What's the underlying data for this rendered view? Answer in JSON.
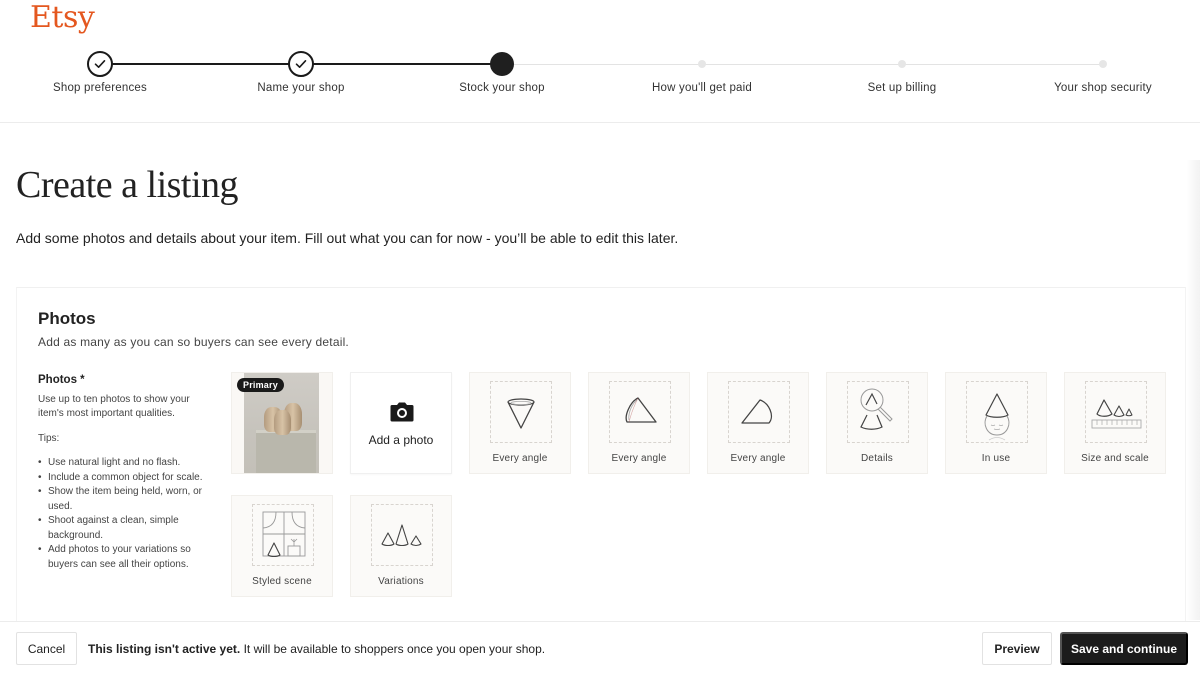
{
  "brand": {
    "name": "Etsy",
    "color": "#e4571f"
  },
  "stepper": {
    "current_index": 2,
    "steps": [
      {
        "label": "Shop preferences",
        "state": "complete"
      },
      {
        "label": "Name your shop",
        "state": "complete"
      },
      {
        "label": "Stock your shop",
        "state": "current"
      },
      {
        "label": "How you'll get paid",
        "state": "pending"
      },
      {
        "label": "Set up billing",
        "state": "pending"
      },
      {
        "label": "Your shop security",
        "state": "pending"
      }
    ]
  },
  "page": {
    "title": "Create a listing",
    "subtitle": "Add some photos and details about your item. Fill out what you can for now - you’ll be able to edit this later."
  },
  "photos_section": {
    "title": "Photos",
    "description": "Add as many as you can so buyers can see every detail.",
    "field_label": "Photos *",
    "field_intro": "Use up to ten photos to show your item's most important qualities.",
    "tips_label": "Tips:",
    "tips": [
      "Use natural light and no flash.",
      "Include a common object for scale.",
      "Show the item being held, worn, or used.",
      "Shoot against a clean, simple background.",
      "Add photos to your variations so buyers can see all their options."
    ],
    "primary_badge": "Primary",
    "add_photo_label": "Add a photo",
    "add_photo_icon": "camera-icon",
    "slots": [
      {
        "label": "Every angle",
        "icon": "cone-front-icon"
      },
      {
        "label": "Every angle",
        "icon": "cone-side-icon"
      },
      {
        "label": "Every angle",
        "icon": "cone-back-icon"
      },
      {
        "label": "Details",
        "icon": "magnifier-cone-icon"
      },
      {
        "label": "In use",
        "icon": "cone-hat-face-icon"
      },
      {
        "label": "Size and scale",
        "icon": "cones-ruler-icon"
      },
      {
        "label": "Styled scene",
        "icon": "window-scene-icon"
      },
      {
        "label": "Variations",
        "icon": "three-cones-icon"
      }
    ]
  },
  "footer": {
    "cancel_label": "Cancel",
    "notice_bold": "This listing isn't active yet.",
    "notice_rest": " It will be available to shoppers once you open your shop.",
    "preview_label": "Preview",
    "save_label": "Save and continue"
  }
}
